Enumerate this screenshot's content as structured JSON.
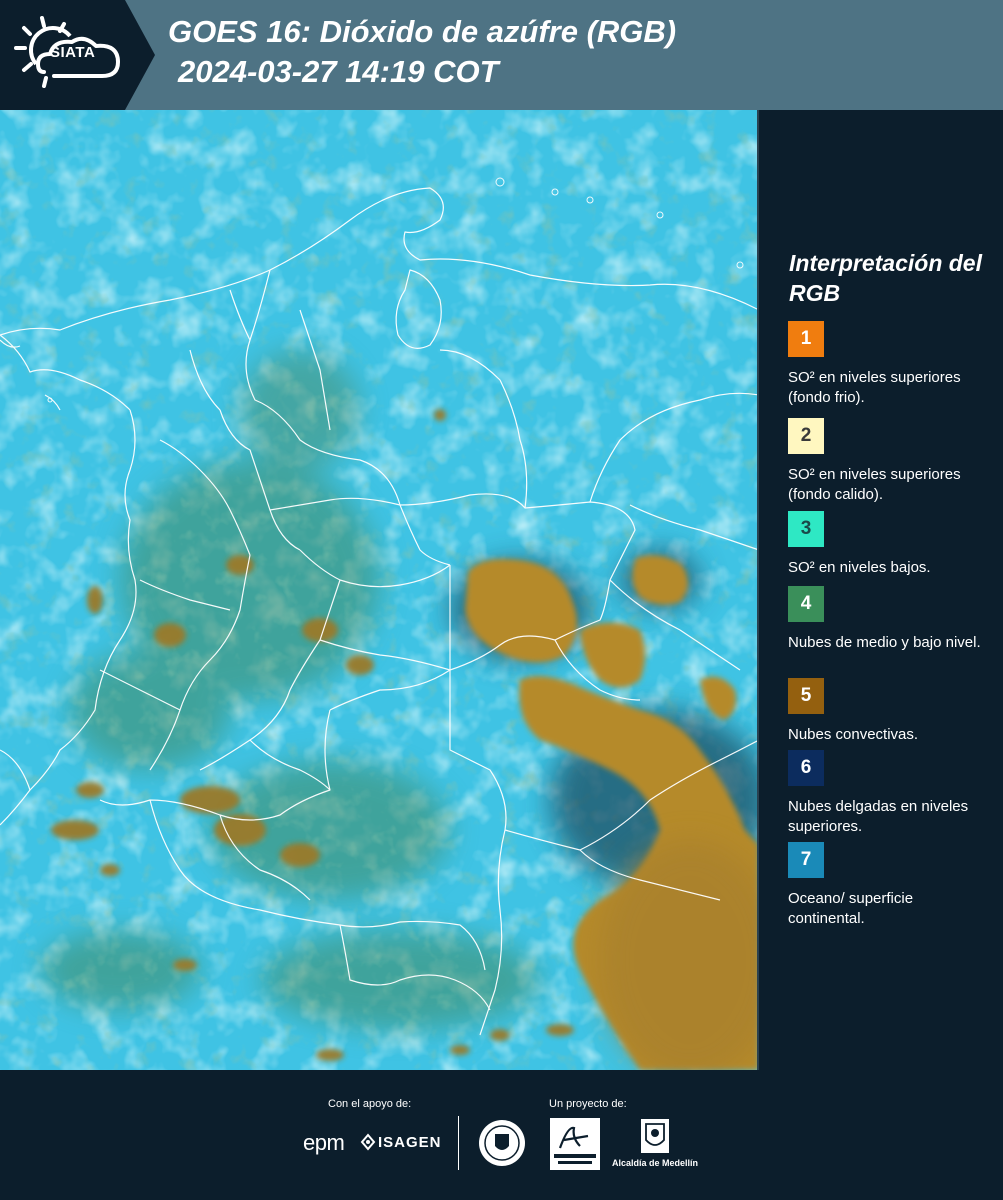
{
  "header": {
    "logo_text": "SIATA",
    "title_line1": "GOES 16: Dióxido de azúfre (RGB)",
    "title_line2": "2024-03-27 14:19 COT"
  },
  "legend": {
    "title": "Interpretación del RGB",
    "items": [
      {
        "number": "1",
        "color": "#f07d0f",
        "text": "SO² en niveles superiores (fondo frio)."
      },
      {
        "number": "2",
        "color": "#fff7c0",
        "text": "SO² en niveles superiores (fondo calido)."
      },
      {
        "number": "3",
        "color": "#2ee8c4",
        "text": "SO² en niveles bajos."
      },
      {
        "number": "4",
        "color": "#3a8f5a",
        "text": "Nubes de medio y bajo nivel."
      },
      {
        "number": "5",
        "color": "#94600f",
        "text": "Nubes convectivas."
      },
      {
        "number": "6",
        "color": "#0c2c5e",
        "text": "Nubes delgadas en niveles superiores."
      },
      {
        "number": "7",
        "color": "#1a8ab8",
        "text": "Oceano/ superficie continental."
      }
    ]
  },
  "footer": {
    "support_label": "Con el apoyo de:",
    "project_label": "Un proyecto de:",
    "sponsor_epm": "epm",
    "sponsor_isagen": "ISAGEN",
    "alcaldia_label": "Alcaldía de Medellín"
  },
  "map": {
    "colors": {
      "background": "#3fc3e4",
      "light_cloud": "#a8eef8",
      "convective": "#b58a2a",
      "mid_low": "#3f8a63",
      "border": "#ffffff"
    }
  }
}
